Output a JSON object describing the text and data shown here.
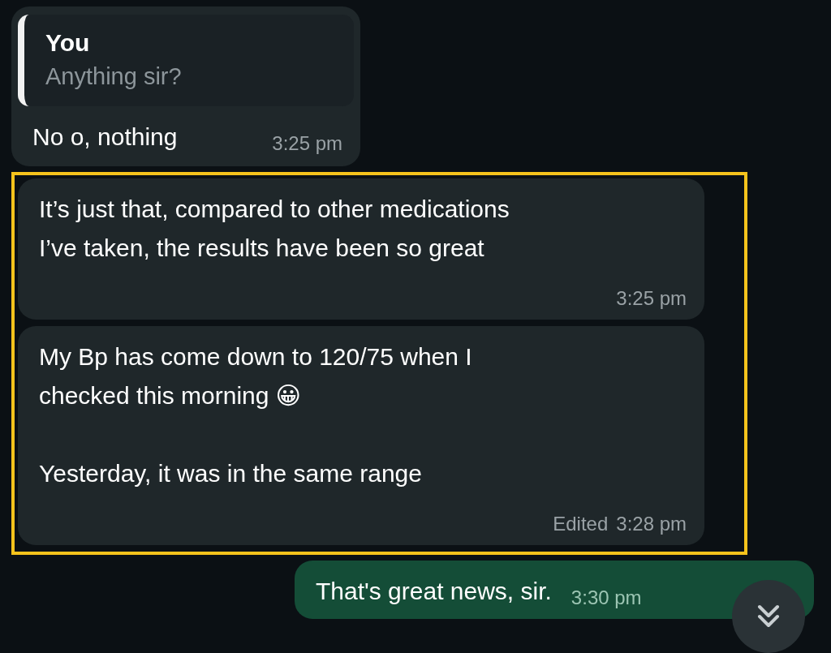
{
  "chat": [
    {
      "kind": "incoming",
      "quote": {
        "author": "You",
        "text": "Anything sir?"
      },
      "text": "No o, nothing",
      "time": "3:25 pm"
    },
    {
      "kind": "highlight",
      "messages": [
        {
          "kind": "incoming",
          "text": "It’s just that, compared to other medications\nI’ve taken, the results have been so great",
          "time": "3:25 pm"
        },
        {
          "kind": "incoming",
          "text": "My Bp has come down to 120/75 when I\nchecked this morning 😀\n\nYesterday, it was in the same range",
          "edited": "Edited",
          "time": "3:28 pm"
        }
      ]
    },
    {
      "kind": "outgoing",
      "text": "That's great news, sir.",
      "time": "3:30 pm"
    }
  ]
}
